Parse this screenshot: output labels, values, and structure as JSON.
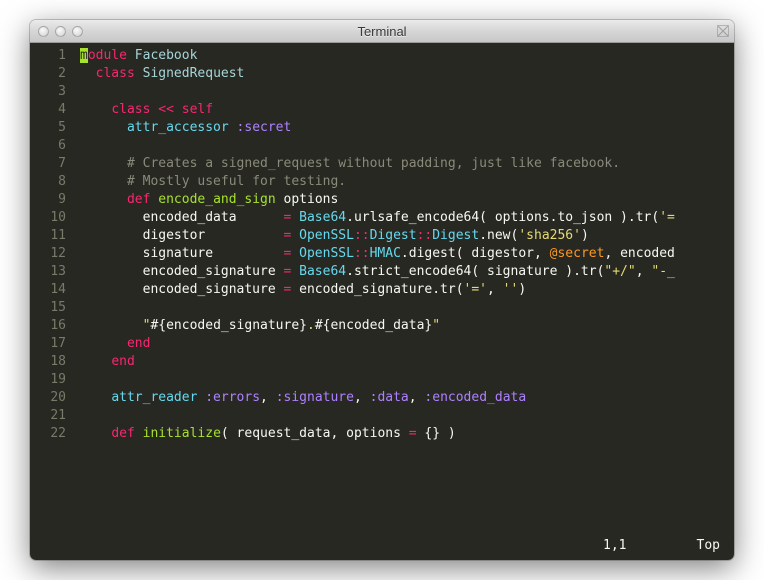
{
  "window": {
    "title": "Terminal"
  },
  "editor": {
    "status_pos": "1,1",
    "status_scroll": "Top"
  },
  "lines": [
    {
      "n": "1",
      "t": [
        [
          "cursor",
          "m"
        ],
        [
          "kw",
          "odule"
        ],
        [
          "",
          " "
        ],
        [
          "cls",
          "Facebook"
        ]
      ]
    },
    {
      "n": "2",
      "t": [
        [
          "",
          "  "
        ],
        [
          "kw",
          "class"
        ],
        [
          "",
          " "
        ],
        [
          "cls",
          "SignedRequest"
        ]
      ]
    },
    {
      "n": "3",
      "t": [
        [
          "",
          ""
        ]
      ]
    },
    {
      "n": "4",
      "t": [
        [
          "",
          "    "
        ],
        [
          "kw",
          "class"
        ],
        [
          "",
          " "
        ],
        [
          "op",
          "<<"
        ],
        [
          "",
          " "
        ],
        [
          "kw",
          "self"
        ]
      ]
    },
    {
      "n": "5",
      "t": [
        [
          "",
          "      "
        ],
        [
          "attr",
          "attr_accessor"
        ],
        [
          "",
          " "
        ],
        [
          "sym",
          ":secret"
        ]
      ]
    },
    {
      "n": "6",
      "t": [
        [
          "",
          ""
        ]
      ]
    },
    {
      "n": "7",
      "t": [
        [
          "",
          "      "
        ],
        [
          "cmt",
          "# Creates a signed_request without padding, just like facebook."
        ]
      ]
    },
    {
      "n": "8",
      "t": [
        [
          "",
          "      "
        ],
        [
          "cmt",
          "# Mostly useful for testing."
        ]
      ]
    },
    {
      "n": "9",
      "t": [
        [
          "",
          "      "
        ],
        [
          "kw",
          "def"
        ],
        [
          "",
          " "
        ],
        [
          "fn",
          "encode_and_sign"
        ],
        [
          "",
          " options"
        ]
      ]
    },
    {
      "n": "10",
      "t": [
        [
          "",
          "        encoded_data      "
        ],
        [
          "op",
          "="
        ],
        [
          "",
          " "
        ],
        [
          "const",
          "Base64"
        ],
        [
          "",
          "."
        ],
        [
          "",
          "urlsafe_encode64( options.to_json ).tr("
        ],
        [
          "str",
          "'="
        ]
      ]
    },
    {
      "n": "11",
      "t": [
        [
          "",
          "        digestor          "
        ],
        [
          "op",
          "="
        ],
        [
          "",
          " "
        ],
        [
          "const",
          "OpenSSL"
        ],
        [
          "op",
          "::"
        ],
        [
          "const",
          "Digest"
        ],
        [
          "op",
          "::"
        ],
        [
          "const",
          "Digest"
        ],
        [
          "",
          ".new("
        ],
        [
          "str",
          "'sha256'"
        ],
        [
          "",
          ")"
        ]
      ]
    },
    {
      "n": "12",
      "t": [
        [
          "",
          "        signature         "
        ],
        [
          "op",
          "="
        ],
        [
          "",
          " "
        ],
        [
          "const",
          "OpenSSL"
        ],
        [
          "op",
          "::"
        ],
        [
          "const",
          "HMAC"
        ],
        [
          "",
          ".digest( digestor, "
        ],
        [
          "at",
          "@secret"
        ],
        [
          "",
          ", encoded"
        ]
      ]
    },
    {
      "n": "13",
      "t": [
        [
          "",
          "        encoded_signature "
        ],
        [
          "op",
          "="
        ],
        [
          "",
          " "
        ],
        [
          "const",
          "Base64"
        ],
        [
          "",
          ".strict_encode64( signature ).tr("
        ],
        [
          "str",
          "\"+/\""
        ],
        [
          "",
          ", "
        ],
        [
          "str",
          "\"-_"
        ]
      ]
    },
    {
      "n": "14",
      "t": [
        [
          "",
          "        encoded_signature "
        ],
        [
          "op",
          "="
        ],
        [
          "",
          " encoded_signature.tr("
        ],
        [
          "str",
          "'='"
        ],
        [
          "",
          ", "
        ],
        [
          "str",
          "''"
        ],
        [
          "",
          ")"
        ]
      ]
    },
    {
      "n": "15",
      "t": [
        [
          "",
          ""
        ]
      ]
    },
    {
      "n": "16",
      "t": [
        [
          "",
          "        "
        ],
        [
          "str",
          "\""
        ],
        [
          "interp",
          "#{"
        ],
        [
          "",
          "encoded_signature"
        ],
        [
          "interp",
          "}"
        ],
        [
          "str",
          "."
        ],
        [
          "interp",
          "#{"
        ],
        [
          "",
          "encoded_data"
        ],
        [
          "interp",
          "}"
        ],
        [
          "str",
          "\""
        ]
      ]
    },
    {
      "n": "17",
      "t": [
        [
          "",
          "      "
        ],
        [
          "kw",
          "end"
        ]
      ]
    },
    {
      "n": "18",
      "t": [
        [
          "",
          "    "
        ],
        [
          "kw",
          "end"
        ]
      ]
    },
    {
      "n": "19",
      "t": [
        [
          "",
          ""
        ]
      ]
    },
    {
      "n": "20",
      "t": [
        [
          "",
          "    "
        ],
        [
          "attr",
          "attr_reader"
        ],
        [
          "",
          " "
        ],
        [
          "sym",
          ":errors"
        ],
        [
          "",
          ", "
        ],
        [
          "sym",
          ":signature"
        ],
        [
          "",
          ", "
        ],
        [
          "sym",
          ":data"
        ],
        [
          "",
          ", "
        ],
        [
          "sym",
          ":encoded_data"
        ]
      ]
    },
    {
      "n": "21",
      "t": [
        [
          "",
          ""
        ]
      ]
    },
    {
      "n": "22",
      "t": [
        [
          "",
          "    "
        ],
        [
          "kw",
          "def"
        ],
        [
          "",
          " "
        ],
        [
          "fn",
          "initialize"
        ],
        [
          "",
          "( request_data, options "
        ],
        [
          "op",
          "="
        ],
        [
          "",
          " {} )"
        ]
      ]
    }
  ]
}
